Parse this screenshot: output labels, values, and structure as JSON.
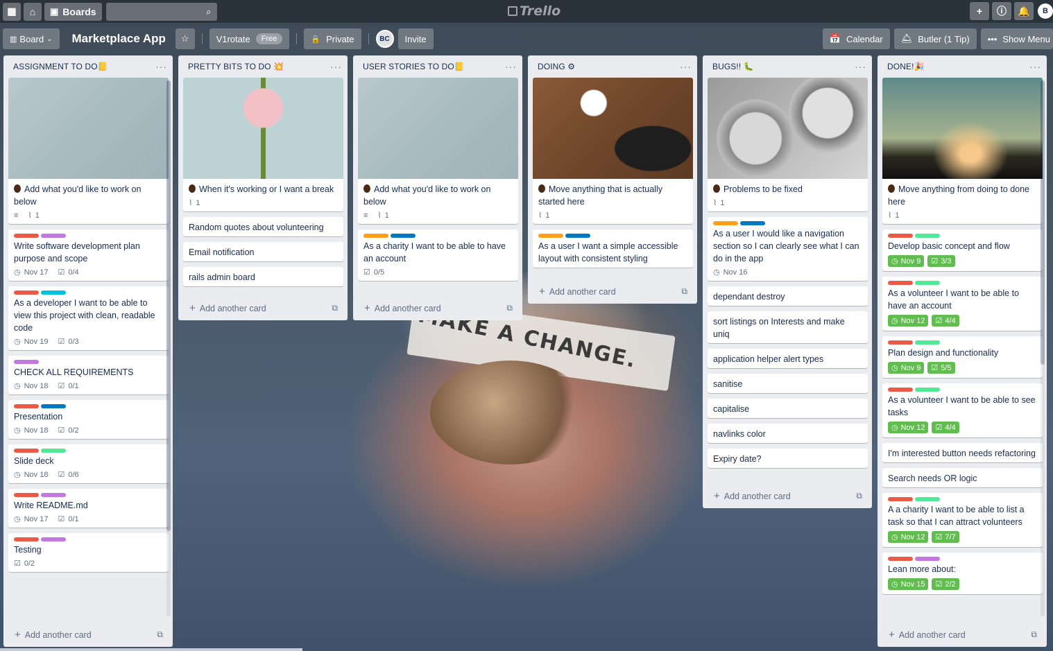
{
  "topbar": {
    "boards_label": "Boards",
    "logo_text": "Trello",
    "user_initial": "B"
  },
  "board": {
    "view_label": "Board",
    "title": "Marketplace App",
    "team": "V1rotate",
    "team_badge": "Free",
    "visibility": "Private",
    "member_initials": "BC",
    "invite_label": "Invite",
    "calendar_label": "Calendar",
    "butler_label": "Butler (1 Tip)",
    "menu_label": "Show Menu"
  },
  "colors": {
    "red": "#eb5a46",
    "purple": "#c377e0",
    "sky": "#00c2e0",
    "blue": "#0079bf",
    "green": "#61bd4f",
    "lime": "#51e898",
    "orange": "#ff9f1a",
    "yellow": "#f2d600"
  },
  "lists": [
    {
      "title": "ASSIGNMENT TO DO📒",
      "cards": [
        {
          "cover": "sticky-notes",
          "bean": true,
          "title": "Add what you'd like to work on below",
          "description": true,
          "attachments": "1"
        },
        {
          "labels": [
            "red",
            "purple"
          ],
          "title": "Write software development plan purpose and scope",
          "due": "Nov 17",
          "checklist": "0/4"
        },
        {
          "labels": [
            "red",
            "sky"
          ],
          "title": "As a developer I want to be able to view this project with clean, readable code",
          "due": "Nov 19",
          "checklist": "0/3"
        },
        {
          "labels": [
            "purple"
          ],
          "title": "CHECK ALL REQUIREMENTS",
          "due": "Nov 18",
          "checklist": "0/1"
        },
        {
          "labels": [
            "red",
            "blue"
          ],
          "title": "Presentation",
          "due": "Nov 18",
          "checklist": "0/2"
        },
        {
          "labels": [
            "red",
            "lime"
          ],
          "title": "Slide deck",
          "due": "Nov 18",
          "checklist": "0/6"
        },
        {
          "labels": [
            "red",
            "purple"
          ],
          "title": "Write README.md",
          "due": "Nov 17",
          "checklist": "0/1"
        },
        {
          "labels": [
            "red",
            "purple"
          ],
          "title": "Testing",
          "checklist": "0/2"
        }
      ],
      "add_label": "Add another card"
    },
    {
      "title": "PRETTY BITS TO DO 💥",
      "cards": [
        {
          "cover": "flower",
          "bean": true,
          "title": "When it's working or I want a break",
          "attachments": "1"
        },
        {
          "title": "Random quotes about volunteering"
        },
        {
          "title": "Email notification"
        },
        {
          "title": "rails admin board"
        }
      ],
      "add_label": "Add another card"
    },
    {
      "title": "USER STORIES TO DO📒",
      "cards": [
        {
          "cover": "sticky-notes",
          "bean": true,
          "title": "Add what you'd like to work on below",
          "description": true,
          "attachments": "1"
        },
        {
          "labels": [
            "orange",
            "blue"
          ],
          "title": "As a charity I want to be able to have an account",
          "checklist": "0/5"
        }
      ],
      "add_label": "Add another card"
    },
    {
      "title": "DOING ⚙",
      "cards": [
        {
          "cover": "desk",
          "bean": true,
          "title": "Move anything that is actually started here",
          "attachments": "1"
        },
        {
          "labels": [
            "orange",
            "blue"
          ],
          "title": "As a user I want a simple accessible layout with consistent styling"
        }
      ],
      "add_label": "Add another card"
    },
    {
      "title": "BUGS!! 🐛",
      "cards": [
        {
          "cover": "gears",
          "bean": true,
          "title": "Problems to be fixed",
          "attachments": "1"
        },
        {
          "labels": [
            "orange",
            "blue"
          ],
          "title": "As a user I would like a navigation section so I can clearly see what I can do in the app",
          "due": "Nov 16"
        },
        {
          "title": "dependant destroy"
        },
        {
          "title": "sort listings on Interests and make uniq"
        },
        {
          "title": "application helper alert types"
        },
        {
          "title": "sanitise"
        },
        {
          "title": "capitalise"
        },
        {
          "title": "navlinks color"
        },
        {
          "title": "Expiry date?"
        }
      ],
      "add_label": "Add another card"
    },
    {
      "title": "DONE!🎉",
      "cards": [
        {
          "cover": "sunset",
          "bean": true,
          "title": "Move anything from doing to done here",
          "attachments": "1"
        },
        {
          "labels": [
            "red",
            "lime"
          ],
          "title": "Develop basic concept and flow",
          "due_done": "Nov 9",
          "checklist_done": "3/3"
        },
        {
          "labels": [
            "red",
            "lime"
          ],
          "title": "As a volunteer I want to be able to have an account",
          "due_done": "Nov 12",
          "checklist_done": "4/4"
        },
        {
          "labels": [
            "red",
            "lime"
          ],
          "title": "Plan design and functionality",
          "due_done": "Nov 9",
          "checklist_done": "5/5"
        },
        {
          "labels": [
            "red",
            "lime"
          ],
          "title": "As a volunteer I want to be able to see tasks",
          "due_done": "Nov 12",
          "checklist_done": "4/4"
        },
        {
          "title": "I'm interested button needs refactoring"
        },
        {
          "title": "Search needs OR logic"
        },
        {
          "labels": [
            "red",
            "lime"
          ],
          "title": "A a charity I want to be able to list a task so that I can attract volunteers",
          "due_done": "Nov 12",
          "checklist_done": "7/7"
        },
        {
          "labels": [
            "red",
            "purple"
          ],
          "title": "Lean more about:",
          "due_done": "Nov 15",
          "checklist_done": "2/2"
        }
      ],
      "add_label": "Add another card"
    }
  ],
  "background_note_text": "MAKE A CHANGE."
}
